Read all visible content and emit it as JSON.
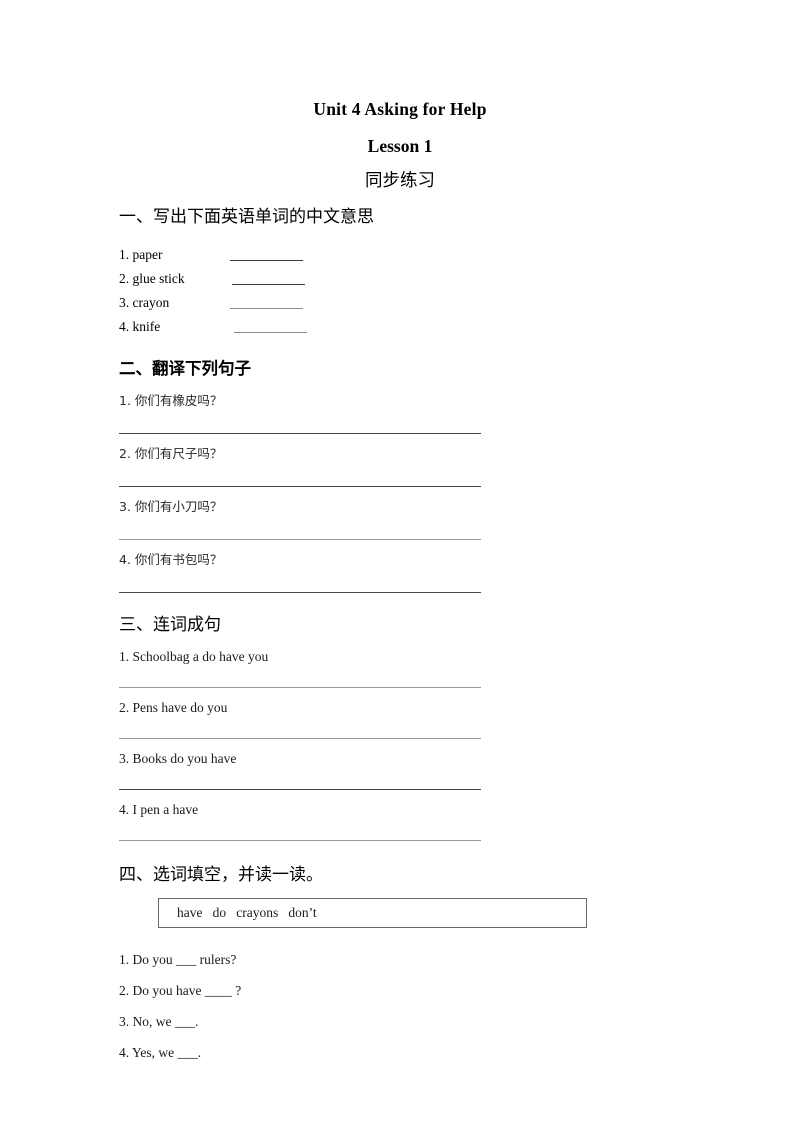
{
  "document": {
    "title_main": "Unit 4 Asking for Help",
    "title_sub": "Lesson 1",
    "title_cn": "同步练习"
  },
  "sections": [
    {
      "heading": "一、写出下面英语单词的中文意思",
      "words": [
        {
          "label": "1. paper"
        },
        {
          "label": "2. glue stick"
        },
        {
          "label": "3. crayon"
        },
        {
          "label": "4. knife"
        }
      ]
    },
    {
      "heading": "二、翻译下列句子",
      "questions": [
        "1. 你们有橡皮吗？",
        "2. 你们有尺子吗？",
        "3. 你们有小刀吗？",
        "4. 你们有书包吗？"
      ]
    },
    {
      "heading": "三、连词成句",
      "questions": [
        "1. Schoolbag a do have you",
        "2. Pens have do you",
        "3. Books do you have",
        "4. I pen a have"
      ]
    },
    {
      "heading": "四、选词填空，并读一读。",
      "wordbank": "have   do   crayons   don’t",
      "questions": [
        "1. Do you ___ rulers?",
        "2. Do you have ____ ?",
        "3. No, we ___.",
        "4. Yes, we ___."
      ]
    }
  ]
}
